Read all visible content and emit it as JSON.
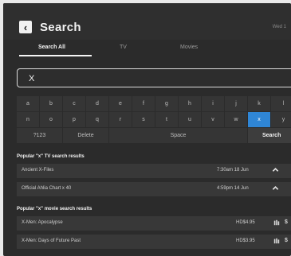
{
  "header": {
    "title": "Search",
    "corner_text": "Wed 1"
  },
  "tabs": [
    "Search All",
    "TV",
    "Movies"
  ],
  "search": {
    "value": "X"
  },
  "keyboard": {
    "row1": [
      "a",
      "b",
      "c",
      "d",
      "e",
      "f",
      "g",
      "h",
      "i",
      "j",
      "k",
      "l"
    ],
    "row2": [
      "n",
      "o",
      "p",
      "q",
      "r",
      "s",
      "t",
      "u",
      "v",
      "w",
      "x",
      "y"
    ],
    "row3": [
      "?123",
      "Delete",
      "Space",
      "Search"
    ],
    "selected_key": "x"
  },
  "tv_results": {
    "title": "Popular \"x\" TV search results",
    "items": [
      {
        "title": "Ancient X-Files",
        "time": "7:30am 18 Jun"
      },
      {
        "title": "Official Ahlia Chart x 40",
        "time": "4:59pm 14 Jun"
      }
    ]
  },
  "movie_results": {
    "title": "Popular \"x\" movie search results",
    "items": [
      {
        "title": "X-Men: Apocalypse",
        "price": "HD$4.95",
        "symbol": "$"
      },
      {
        "title": "X-Men: Days of Future Past",
        "price": "HD$3.95",
        "symbol": "$"
      }
    ]
  }
}
